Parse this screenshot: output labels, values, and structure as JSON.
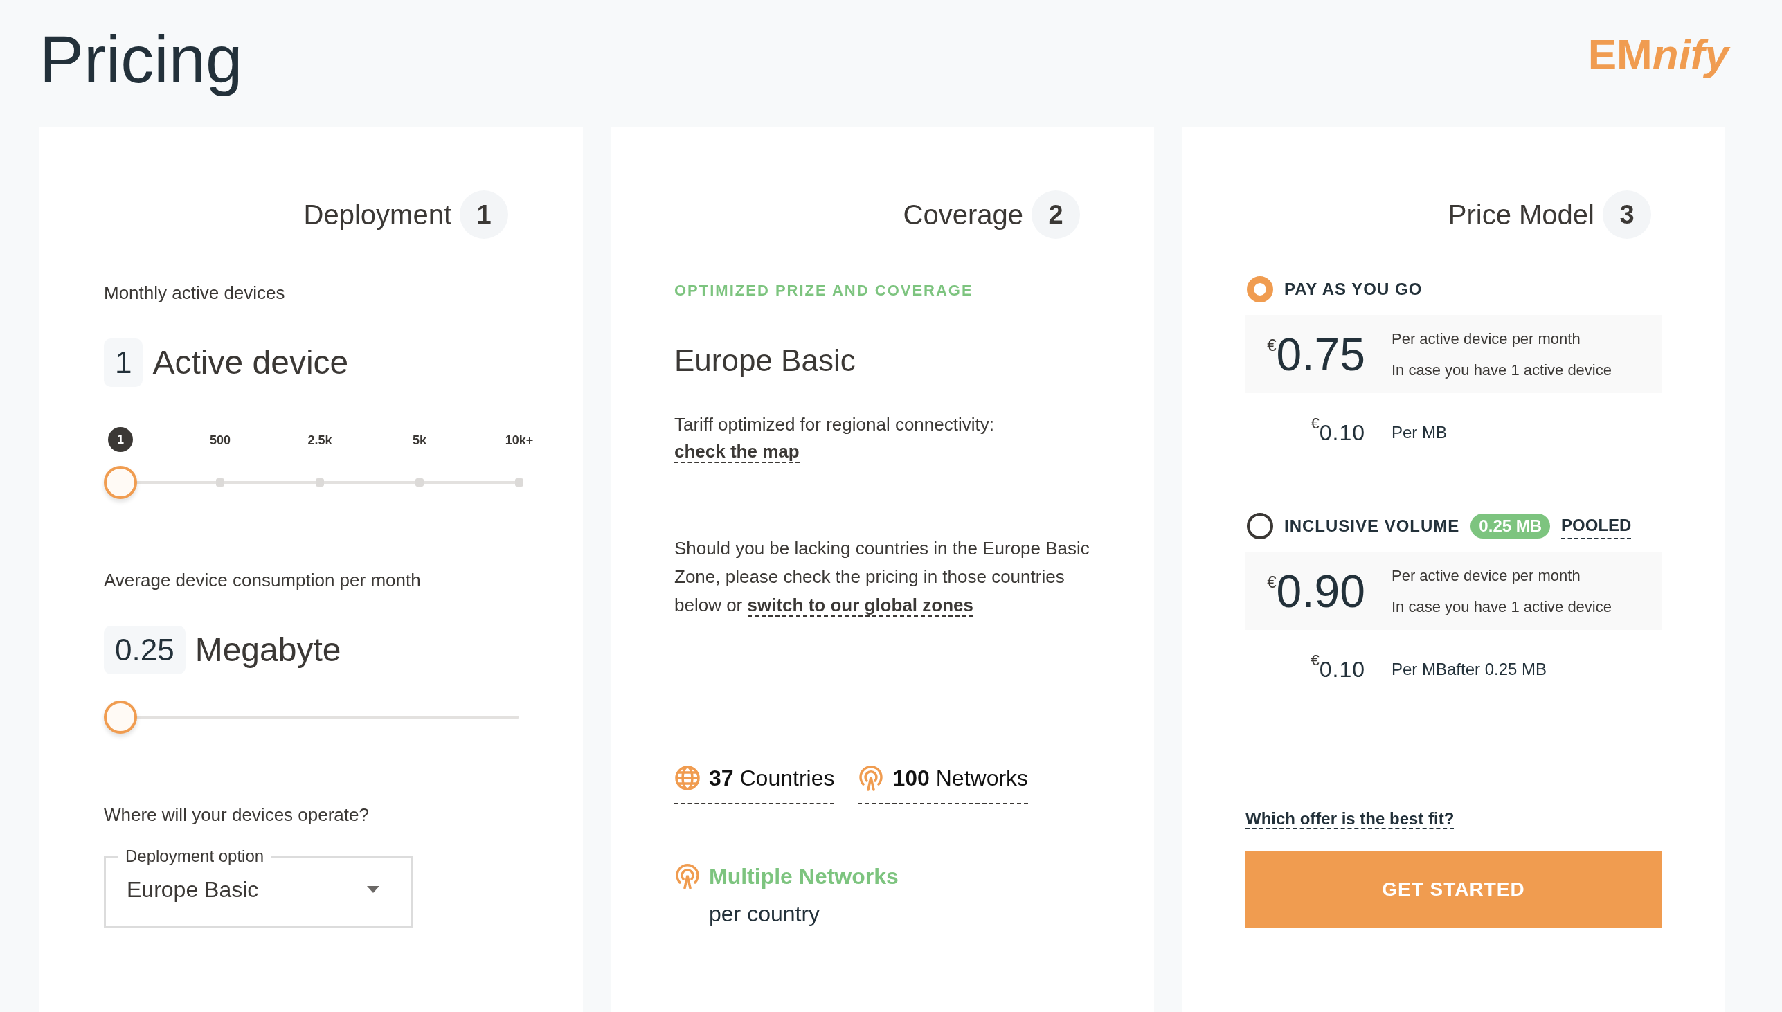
{
  "header": {
    "title": "Pricing",
    "logo_main": "EM",
    "logo_accent": "nify"
  },
  "deployment": {
    "title": "Deployment",
    "step": "1",
    "devices_label": "Monthly active devices",
    "devices_value": "1",
    "devices_unit": "Active device",
    "devices_slider": {
      "level": 0,
      "ticks": [
        {
          "label": "1",
          "selected": true
        },
        {
          "label": "500",
          "selected": false
        },
        {
          "label": "2.5k",
          "selected": false
        },
        {
          "label": "5k",
          "selected": false
        },
        {
          "label": "10k+",
          "selected": false
        }
      ]
    },
    "consumption_label": "Average device consumption per month",
    "consumption_value": "0.25",
    "consumption_unit": "Megabyte",
    "consumption_slider": {
      "level": 0
    },
    "region_label": "Where will your devices operate?",
    "dropdown": {
      "legend": "Deployment option",
      "value": "Europe Basic"
    }
  },
  "coverage": {
    "title": "Coverage",
    "step": "2",
    "eyebrow": "OPTIMIZED PRIZE AND COVERAGE",
    "zone": "Europe Basic",
    "description": "Tariff optimized for regional connectivity:",
    "map_link": "check the map",
    "note": "Should you be lacking countries in the Europe Basic Zone, please check the pricing in those countries below or",
    "note_link": "switch to our global zones",
    "stats": [
      {
        "kind": "globe",
        "count": "37",
        "label": "Countries"
      },
      {
        "kind": "antenna",
        "count": "100",
        "label": "Networks"
      }
    ],
    "networks": {
      "title": "Multiple Networks",
      "subtitle": "per country"
    }
  },
  "price_model": {
    "title": "Price Model",
    "step": "3",
    "options": [
      {
        "label": "PAY AS YOU GO",
        "selected": true,
        "currency": "€",
        "price": "0.75",
        "lines": [
          "Per active device per month",
          "In case you have 1 active device"
        ],
        "data_currency": "€",
        "data_price": "0.10",
        "data_unit": "Per MB"
      },
      {
        "label": "INCLUSIVE VOLUME",
        "selected": false,
        "badge": "0.25 MB",
        "tag": "POOLED",
        "currency": "€",
        "price": "0.90",
        "lines": [
          "Per active device per month",
          "In case you have 1 active device"
        ],
        "data_currency": "€",
        "data_price": "0.10",
        "data_unit": "Per MBafter 0.25 MB"
      }
    ],
    "help_link": "Which offer is the best fit?",
    "cta": "GET STARTED"
  }
}
